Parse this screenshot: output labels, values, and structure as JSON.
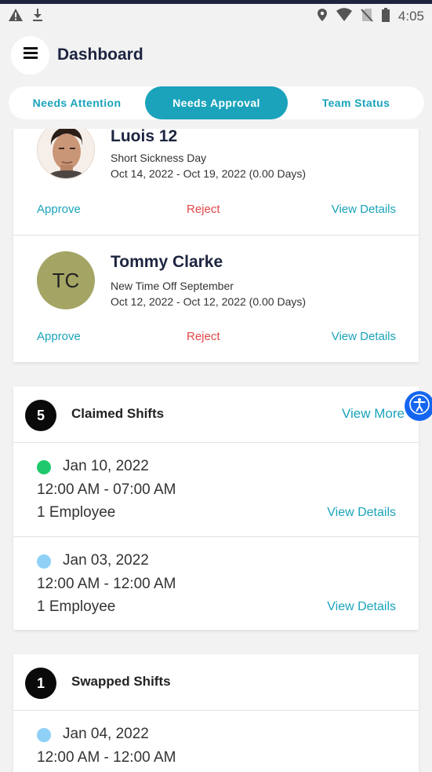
{
  "status_bar": {
    "time": "4:05",
    "left_icons": [
      "warning-icon",
      "download-icon"
    ],
    "right_icons": [
      "location-icon",
      "wifi-icon",
      "no-sim-icon",
      "battery-icon"
    ]
  },
  "header": {
    "title": "Dashboard",
    "menu_icon": "hamburger-menu-icon"
  },
  "tabs": [
    {
      "label": "Needs Attention",
      "active": false
    },
    {
      "label": "Needs Approval",
      "active": true
    },
    {
      "label": "Team Status",
      "active": false
    }
  ],
  "requests": [
    {
      "name": "Luois 12",
      "type": "Short Sickness Day",
      "dates": "Oct 14, 2022 - Oct 19, 2022 (0.00 Days)",
      "avatar": {
        "kind": "photo"
      },
      "approve": "Approve",
      "reject": "Reject",
      "details": "View Details"
    },
    {
      "name": "Tommy Clarke",
      "type": "New Time Off September",
      "dates": "Oct 12, 2022 - Oct 12, 2022 (0.00 Days)",
      "avatar": {
        "kind": "initials",
        "initials": "TC"
      },
      "approve": "Approve",
      "reject": "Reject",
      "details": "View Details"
    }
  ],
  "claimed_shifts": {
    "count": "5",
    "title": "Claimed Shifts",
    "view_more": "View More",
    "items": [
      {
        "date": "Jan 10, 2022",
        "time": "12:00 AM - 07:00 AM",
        "employees": "1 Employee",
        "details": "View Details",
        "status_color": "#1ec96b"
      },
      {
        "date": "Jan 03, 2022",
        "time": "12:00 AM - 12:00 AM",
        "employees": "1 Employee",
        "details": "View Details",
        "status_color": "#8fd0f7"
      }
    ]
  },
  "swapped_shifts": {
    "count": "1",
    "title": "Swapped Shifts",
    "items": [
      {
        "date": "Jan 04, 2022",
        "time": "12:00 AM - 12:00 AM",
        "status_color": "#8fd0f7"
      }
    ]
  },
  "colors": {
    "accent": "#1aa3bb",
    "reject": "#e04848",
    "heading": "#1d2440",
    "accessibility": "#1466f0"
  },
  "accessibility_button": {
    "icon": "accessibility-icon"
  }
}
